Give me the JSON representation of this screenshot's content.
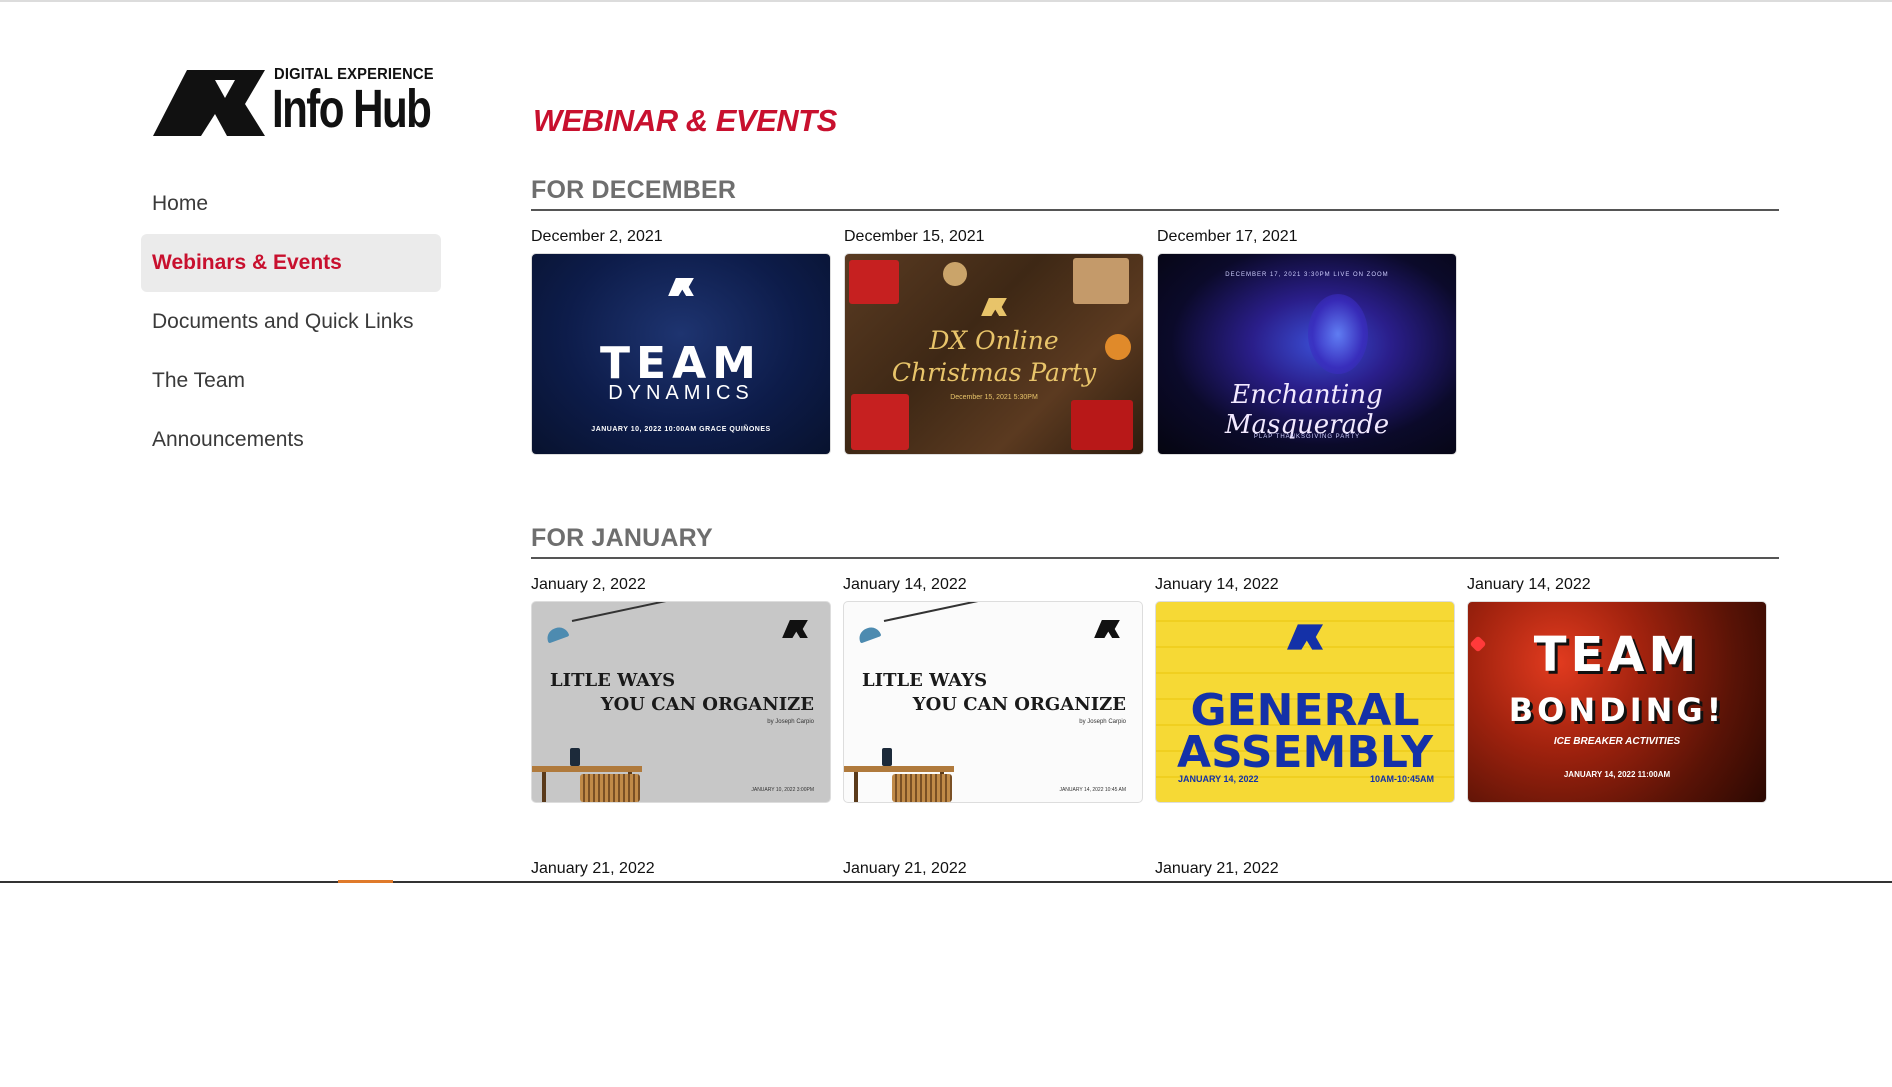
{
  "brand": {
    "small": "DIGITAL EXPERIENCE",
    "big": "Info Hub"
  },
  "nav": {
    "items": [
      {
        "label": "Home"
      },
      {
        "label": "Webinars & Events"
      },
      {
        "label": "Documents and Quick Links"
      },
      {
        "label": "The Team"
      },
      {
        "label": "Announcements"
      }
    ],
    "active": "Webinars & Events"
  },
  "colors": {
    "accent": "#c8102e",
    "section_title": "#6e6e6e"
  },
  "main": {
    "title": "WEBINAR & EVENTS",
    "sections": [
      {
        "title": "FOR DECEMBER",
        "events": [
          {
            "date": "December 2, 2021",
            "thumb": {
              "line1": "TEAM",
              "line2": "DYNAMICS",
              "footer": "JANUARY 10, 2022     10:00AM     GRACE QUIÑONES"
            }
          },
          {
            "date": "December 15, 2021",
            "thumb": {
              "line1": "DX Online",
              "line2": "Christmas Party",
              "footer": "December 15, 2021    5:30PM"
            }
          },
          {
            "date": "December 17, 2021",
            "thumb": {
              "top": "DECEMBER 17, 2021    3:30PM    LIVE ON ZOOM",
              "line1": "Enchanting Masquerade",
              "footer": "PLAP THANKSGIVING PARTY"
            }
          }
        ]
      },
      {
        "title": "FOR JANUARY",
        "events": [
          {
            "date": "January 2, 2022",
            "thumb": {
              "line1": "LITLE WAYS",
              "line2": "YOU CAN ORGANIZE",
              "by": "by Joseph Carpio",
              "footer": "JANUARY 10, 2022   3:00PM"
            }
          },
          {
            "date": "January 14, 2022",
            "thumb": {
              "line1": "LITLE WAYS",
              "line2": "YOU CAN ORGANIZE",
              "by": "by Joseph Carpio",
              "footer": "JANUARY 14, 2022   10:45 AM"
            }
          },
          {
            "date": "January 14, 2022",
            "thumb": {
              "line1": "GENERAL",
              "line2": "ASSEMBLY",
              "footer_left": "JANUARY 14, 2022",
              "footer_right": "10AM-10:45AM"
            }
          },
          {
            "date": "January 14, 2022",
            "thumb": {
              "line1": "TEAM",
              "line2": "BONDING!",
              "sub": "ICE BREAKER ACTIVITIES",
              "footer": "JANUARY 14, 2022   11:00AM"
            }
          }
        ]
      },
      {
        "title": "",
        "events": [
          {
            "date": "January 21, 2022"
          },
          {
            "date": "January 21, 2022"
          },
          {
            "date": "January 21, 2022"
          }
        ]
      }
    ]
  }
}
